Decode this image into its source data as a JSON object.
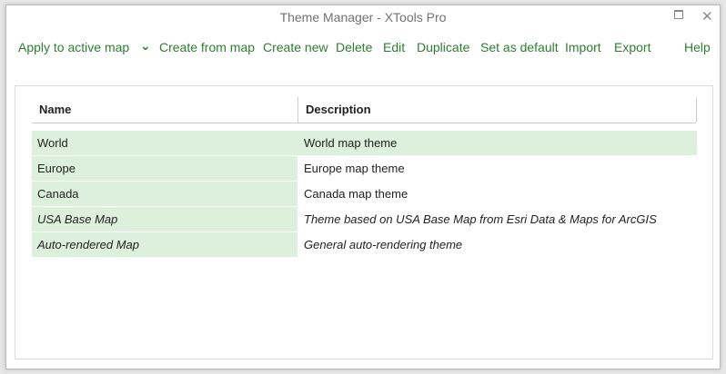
{
  "window": {
    "title": "Theme Manager - XTools Pro",
    "maximize_label": "",
    "close_label": "✕"
  },
  "toolbar": {
    "apply_label": "Apply to active map",
    "apply_chevron": "⌄",
    "create_from_map": "Create from map",
    "create_new": "Create new",
    "delete": "Delete",
    "edit": "Edit",
    "duplicate": "Duplicate",
    "set_default": "Set as default",
    "import": "Import",
    "export": "Export",
    "help": "Help"
  },
  "table": {
    "columns": [
      "Name",
      "Description"
    ],
    "rows": [
      {
        "name": "World",
        "description": "World map theme",
        "selected": true,
        "italic": false
      },
      {
        "name": "Europe",
        "description": "Europe map theme",
        "selected": false,
        "italic": false
      },
      {
        "name": "Canada",
        "description": "Canada map theme",
        "selected": false,
        "italic": false
      },
      {
        "name": "USA Base Map",
        "description": "Theme based on USA Base Map from Esri Data & Maps for ArcGIS",
        "selected": false,
        "italic": true
      },
      {
        "name": "Auto-rendered Map",
        "description": "General auto-rendering theme",
        "selected": false,
        "italic": true
      }
    ]
  },
  "colors": {
    "accent": "#2e7d32",
    "row_highlight": "#dcf0dc"
  }
}
